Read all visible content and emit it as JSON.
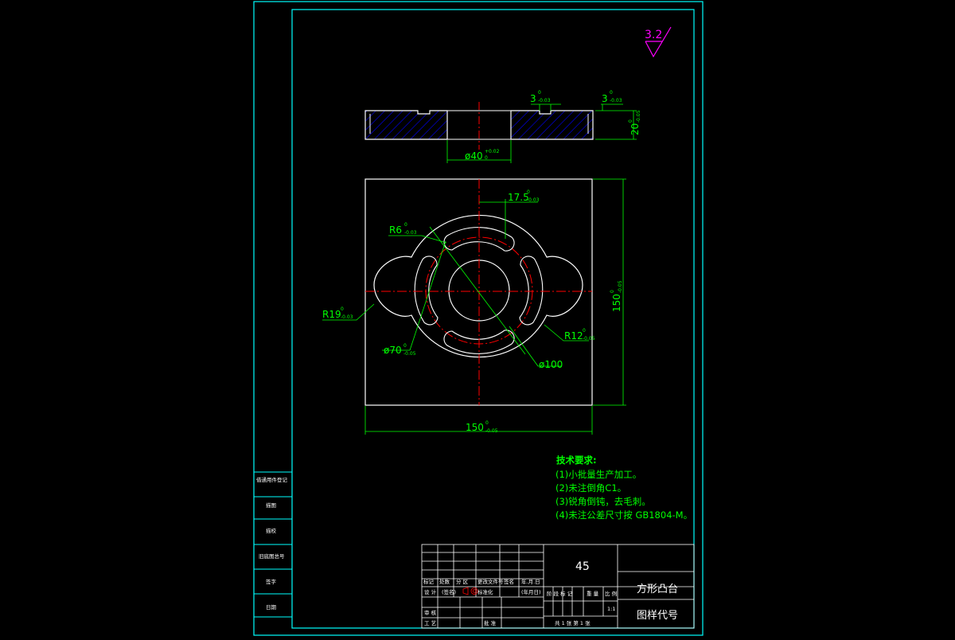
{
  "colors": {
    "background": "#000000",
    "frame": "#00ffff",
    "outline": "#ffffff",
    "centerline": "#ff0000",
    "dimension": "#00ff00",
    "hatch": "#0000ff",
    "roughness": "#ff00ff"
  },
  "roughness": {
    "value": "3.2"
  },
  "section_view": {
    "dims": {
      "groove_left": "3",
      "groove_left_tol_upper": "0",
      "groove_left_tol_lower": "-0.03",
      "groove_right": "3",
      "groove_right_tol_upper": "0",
      "groove_right_tol_lower": "-0.03",
      "thickness": "20",
      "thickness_tol_upper": "0",
      "thickness_tol_lower": "-0.05",
      "bore": "ø40",
      "bore_tol_upper": "+0.02",
      "bore_tol_lower": "0"
    }
  },
  "plan_view": {
    "dims": {
      "slot_offset": "17.5",
      "slot_offset_tol_upper": "0",
      "slot_offset_tol_lower": "-0.03",
      "r6": "R6",
      "r6_tol_upper": "0",
      "r6_tol_lower": "-0.03",
      "r19": "R19",
      "r19_tol_upper": "0",
      "r19_tol_lower": "-0.03",
      "r12": "R12",
      "r12_tol_upper": "0",
      "r12_tol_lower": "-0.05",
      "d70": "ø70",
      "d70_tol_upper": "0",
      "d70_tol_lower": "-0.05",
      "d100": "ø100",
      "height": "150",
      "height_tol_upper": "0",
      "height_tol_lower": "-0.05",
      "width": "150",
      "width_tol_upper": "0",
      "width_tol_lower": "-0.05"
    }
  },
  "tech_requirements": {
    "title": "技术要求:",
    "items": [
      "(1)小批量生产加工。",
      "(2)未注倒角C1。",
      "(3)锐角倒钝，去毛刺。",
      "(4)未注公差尺寸按 GB1804-M。"
    ]
  },
  "left_strip": {
    "labels": [
      "借通用件登记",
      "描图",
      "描校",
      "旧底图总号",
      "签字",
      "日期"
    ]
  },
  "title_block": {
    "material": "45",
    "part_name": "方形凸台",
    "drawing_code": "图样代号",
    "row_labels": [
      "标记",
      "处数",
      "分 区",
      "更改文件号",
      "签名",
      "年.月.日"
    ],
    "design_labels": [
      "设 计",
      "(签名)",
      "标准化",
      "(年月日)"
    ],
    "stage_labels": [
      "阶 段 标 记",
      "重 量",
      "比 例"
    ],
    "scale": "1:1",
    "review_label": "审 核",
    "process_label": "工 艺",
    "approve_label": "批 准",
    "sheet_info": "共 1 张    第 1 张"
  }
}
